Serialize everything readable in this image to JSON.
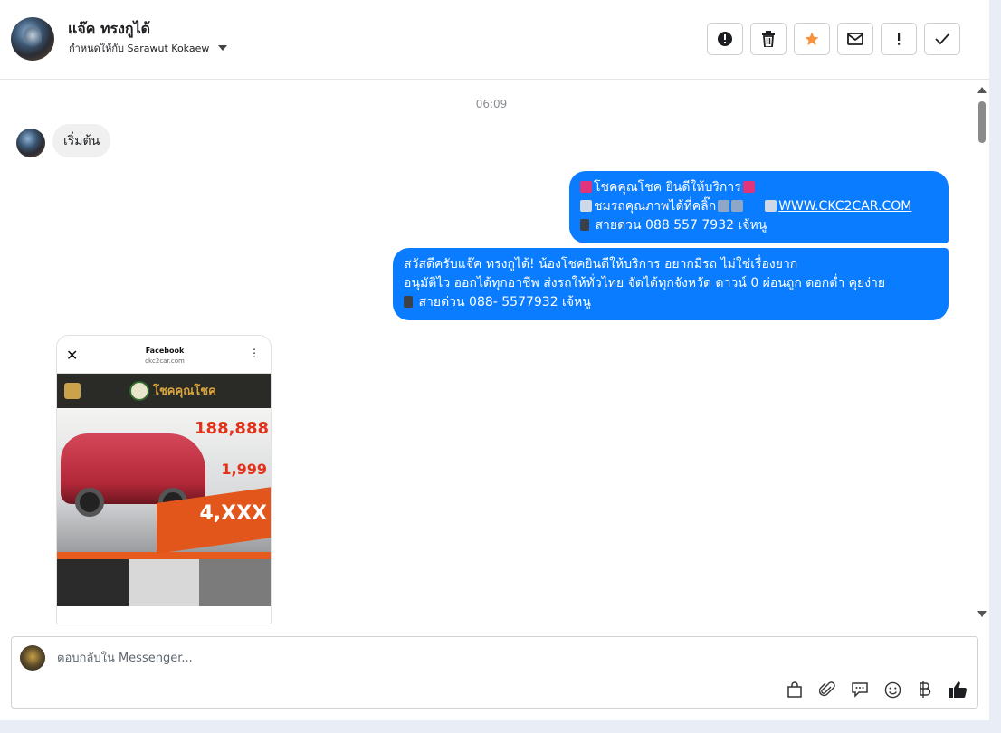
{
  "header": {
    "contact_name": "แจ๊ค ทรงกูได้",
    "assigned_to": "กำหนดให้กับ Sarawut Kokaew",
    "actions": [
      "mark-spam",
      "delete",
      "star",
      "mark-unread",
      "mark-important",
      "done"
    ]
  },
  "chat": {
    "timestamp": "06:09",
    "incoming": {
      "text": "เริ่มต้น"
    },
    "outgoing_1": {
      "line1": "โชคคุณโชค ยินดีให้บริการ",
      "line2": "ชมรถคุณภาพได้ที่คลิ๊ก",
      "link": "WWW.CKC2CAR.COM",
      "line3": "สายด่วน 088 557 7932 เจ้หนู"
    },
    "outgoing_2": {
      "line1": "สวัสดีครับแจ๊ค ทรงกูได้! น้องโชคยินดีให้บริการ อยากมีรถ ไม่ใช่เรื่องยาก",
      "line2": "อนุมัติไว ออกได้ทุกอาชีพ ส่งรถให้ทั่วไทย จัดได้ทุกจังหวัด ดาวน์ 0  ผ่อนถูก ดอกต่ำ คุยง่าย",
      "line3": "สายด่วน 088- 5577932 เจ้หนู"
    },
    "image": {
      "browser_title": "Facebook",
      "browser_url": "ckc2car.com",
      "brand": "โชคคุณโชค",
      "promo_1": "188,888",
      "promo_2": "1,999",
      "promo_3": "4,XXX"
    }
  },
  "composer": {
    "placeholder": "ตอบกลับใน Messenger...",
    "tools": [
      "bag-icon",
      "paperclip-icon",
      "saved-replies-icon",
      "emoji-icon",
      "baht-icon",
      "thumbs-up-icon"
    ]
  },
  "colors": {
    "bubble_out": "#0a7cff",
    "bubble_in": "#f0f0f0",
    "star": "#f7923a"
  }
}
